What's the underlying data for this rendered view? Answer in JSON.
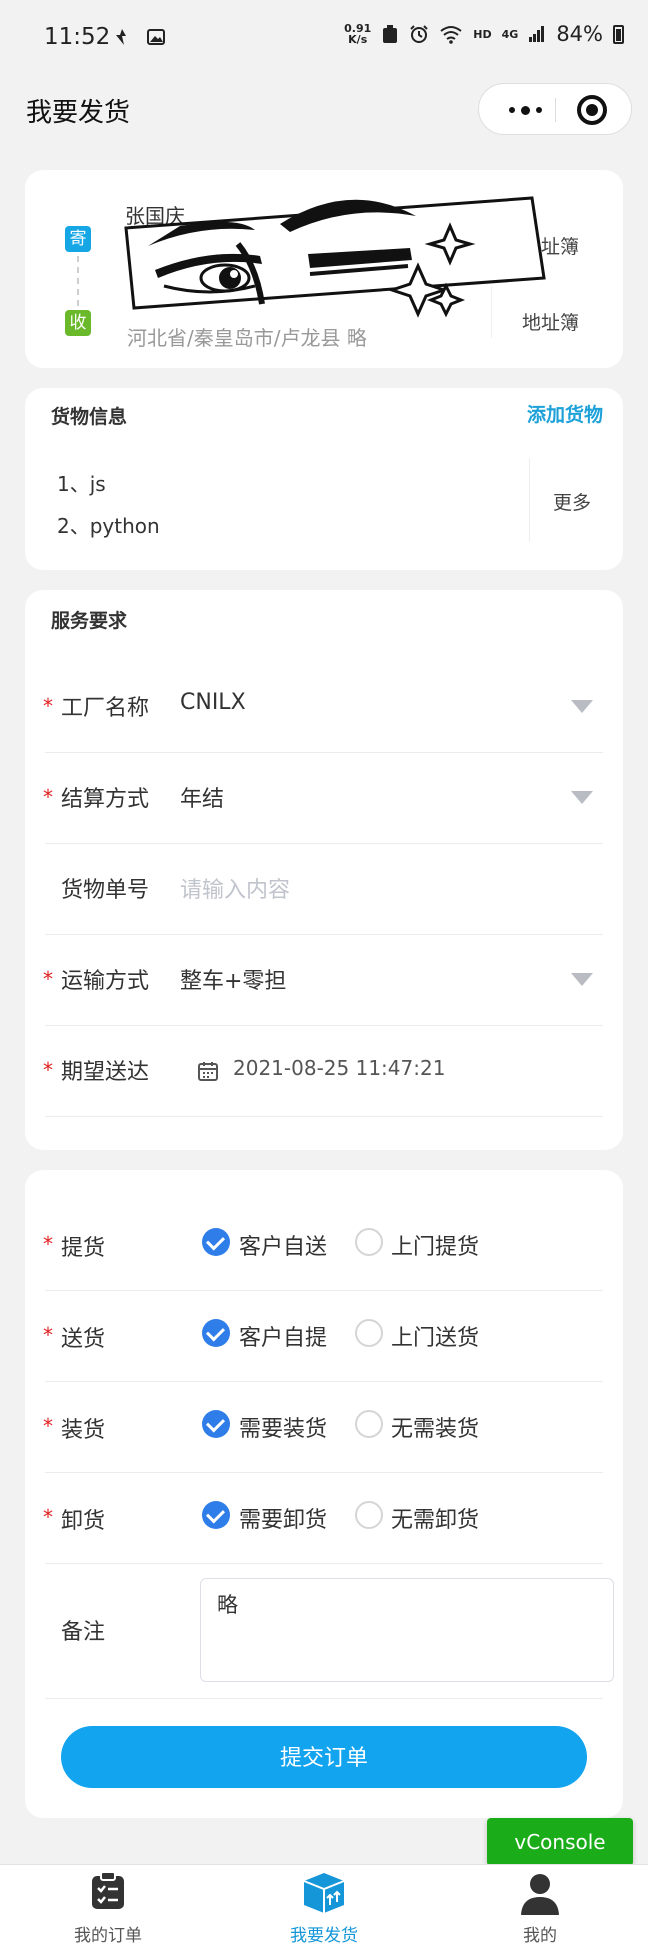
{
  "status_bar": {
    "time": "11:52",
    "net_speed_value": "0.91",
    "net_speed_unit": "K/s",
    "hd_label": "HD",
    "network": "4G",
    "battery": "84%"
  },
  "title_bar": {
    "title": "我要发货"
  },
  "address": {
    "sender_tag": "寄",
    "receiver_tag": "收",
    "sender_text": "张国庆",
    "receiver_address": "河北省/秦皇岛市/卢龙县 略",
    "sender_book_label": "地址簿",
    "receiver_book_label": "地址簿"
  },
  "goods": {
    "title": "货物信息",
    "add_label": "添加货物",
    "items": [
      "1、js",
      "2、python"
    ],
    "more_label": "更多"
  },
  "service": {
    "title": "服务要求",
    "required_mark": "*",
    "factory": {
      "label": "工厂名称",
      "value": "CNILX"
    },
    "settlement": {
      "label": "结算方式",
      "value": "年结"
    },
    "goods_no": {
      "label": "货物单号",
      "placeholder": "请输入内容"
    },
    "transport": {
      "label": "运输方式",
      "value": "整车+零担"
    },
    "expected": {
      "label": "期望送达",
      "value": "2021-08-25 11:47:21"
    }
  },
  "options": {
    "pickup": {
      "label": "提货",
      "option1": "客户自送",
      "option2": "上门提货",
      "selected": 1
    },
    "delivery": {
      "label": "送货",
      "option1": "客户自提",
      "option2": "上门送货",
      "selected": 1
    },
    "loading": {
      "label": "装货",
      "option1": "需要装货",
      "option2": "无需装货",
      "selected": 1
    },
    "unloading": {
      "label": "卸货",
      "option1": "需要卸货",
      "option2": "无需卸货",
      "selected": 1
    },
    "remark": {
      "label": "备注",
      "value": "略"
    },
    "submit_label": "提交订单"
  },
  "vconsole_label": "vConsole",
  "tab_bar": {
    "tabs": [
      {
        "label": "我的订单",
        "icon": "clipboard-list-icon"
      },
      {
        "label": "我要发货",
        "icon": "box-ship-icon",
        "active": true
      },
      {
        "label": "我的",
        "icon": "user-icon"
      }
    ]
  },
  "colors": {
    "accent": "#12a4ef",
    "required": "#e02020",
    "radio_on": "#2f7de8",
    "send_tag": "#15a6e5",
    "receive_tag": "#6ab92b",
    "vconsole": "#1aad19"
  }
}
